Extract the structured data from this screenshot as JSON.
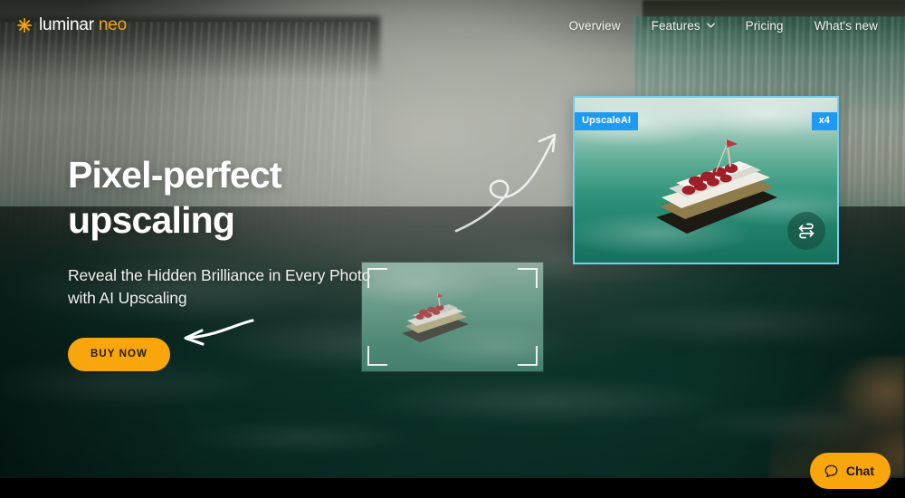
{
  "brand": {
    "name_primary": "luminar",
    "name_secondary": "neo",
    "logo_icon": "asterisk-star-icon",
    "accent_orange": "#f9a60c",
    "accent_blue": "#1e9af0",
    "panel_border_blue": "#6fd0ef"
  },
  "nav": {
    "items": [
      {
        "label": "Overview",
        "has_dropdown": false
      },
      {
        "label": "Features",
        "has_dropdown": true,
        "icon": "chevron-down-icon"
      },
      {
        "label": "Pricing",
        "has_dropdown": false
      },
      {
        "label": "What's new",
        "has_dropdown": false
      }
    ]
  },
  "hero": {
    "heading_line1": "Pixel-perfect",
    "heading_line2": "upscaling",
    "subheading_line1": "Reveal the Hidden Brilliance in Every Photo",
    "subheading_line2": "with AI Upscaling",
    "cta_label": "BUY NOW",
    "cta_arrow_icon": "curved-arrow-left-icon"
  },
  "comparison": {
    "flow_arrow_icon": "curved-loop-arrow-icon",
    "source_panel": {
      "name": "original-image",
      "corner_markers": 4
    },
    "result_panel": {
      "badge_left": "UpscaleAI",
      "badge_right": "x4",
      "swap_icon": "swap-arrows-icon"
    }
  },
  "chat_widget": {
    "label": "Chat",
    "icon": "speech-bubble-icon"
  }
}
